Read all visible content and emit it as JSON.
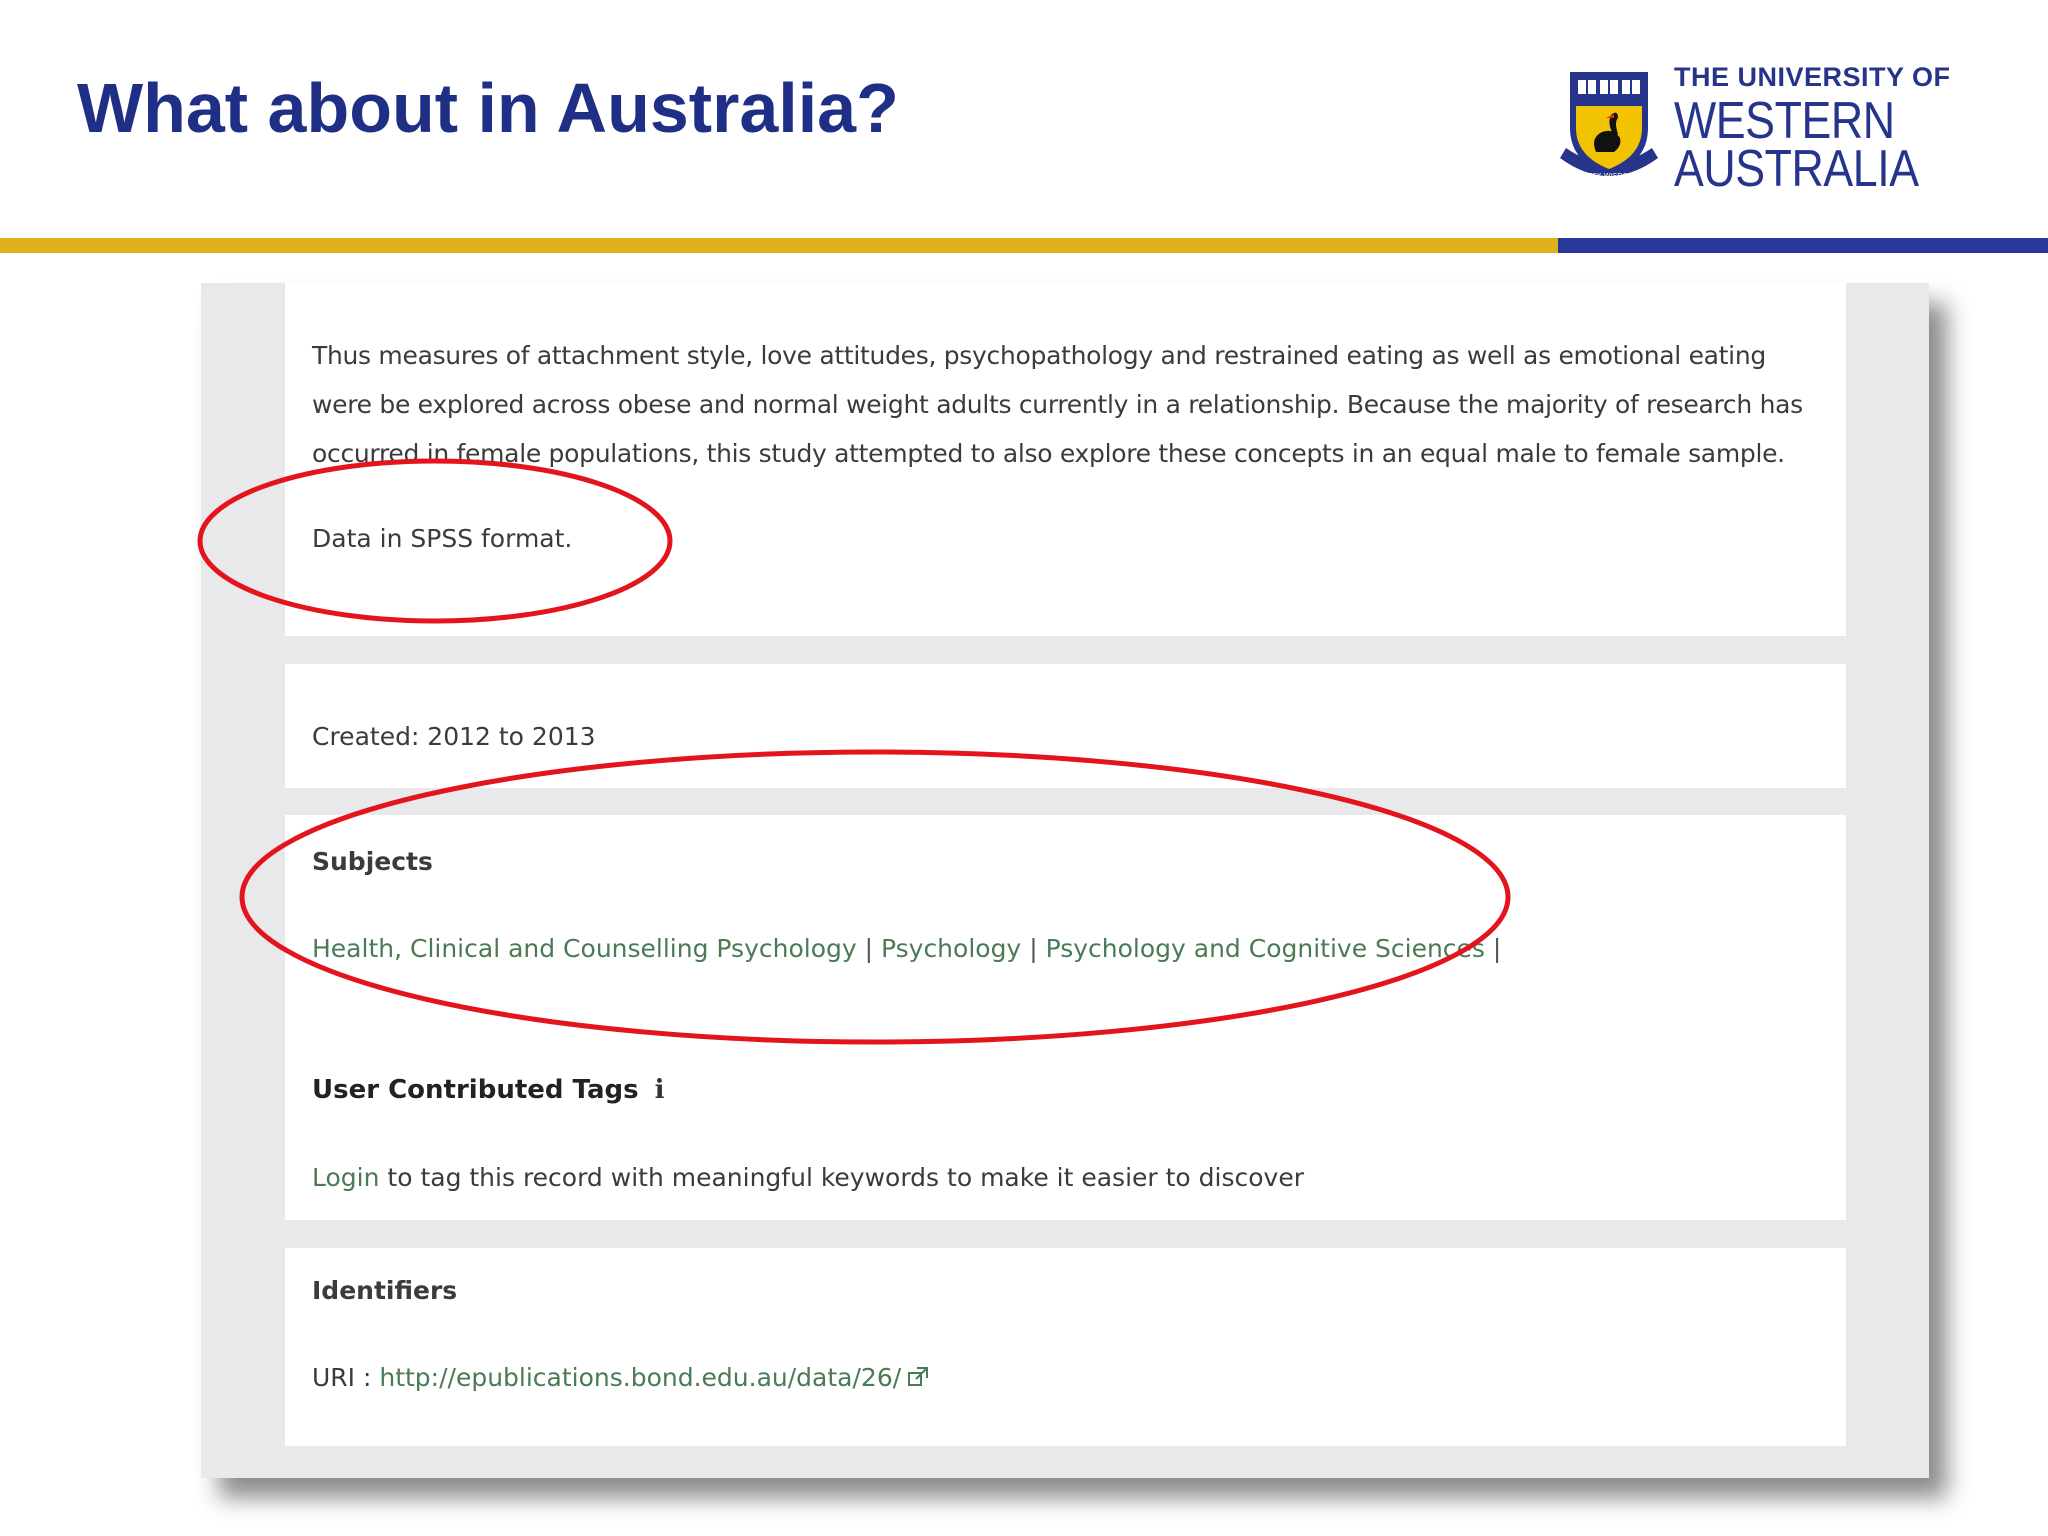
{
  "slide": {
    "title": "What about in Australia?"
  },
  "logo": {
    "line1": "THE UNIVERSITY OF",
    "line2": "WESTERN",
    "line3": "AUSTRALIA",
    "motto": "SEEK WISDOM",
    "icon": "university-crest-icon"
  },
  "colors": {
    "title": "#1f2f86",
    "gold_rule": "#e0b11a",
    "blue_rule": "#27379a",
    "link_green": "#4a7b55",
    "highlight_red": "#e3141c"
  },
  "record": {
    "description": "Thus measures of attachment style, love attitudes, psychopathology and restrained eating as well as emotional eating were be explored across obese and normal weight adults currently in a relationship. Because the majority of research has occurred in female populations, this study attempted to also explore these concepts in an equal male to female sample.",
    "data_format": "Data in SPSS format.",
    "created": "Created: 2012 to 2013",
    "subjects_heading": "Subjects",
    "subjects": [
      "Health, Clinical and Counselling Psychology",
      "Psychology",
      "Psychology and Cognitive Sciences"
    ],
    "separator": "|",
    "tags_heading": "User Contributed Tags",
    "tags_info_icon": "info-icon",
    "login_link": "Login",
    "login_text": " to tag this record with meaningful keywords to make it easier to discover",
    "identifiers_heading": "Identifiers",
    "uri_label": "URI : ",
    "uri_value": "http://epublications.bond.edu.au/data/26/",
    "uri_icon": "external-link-icon"
  }
}
